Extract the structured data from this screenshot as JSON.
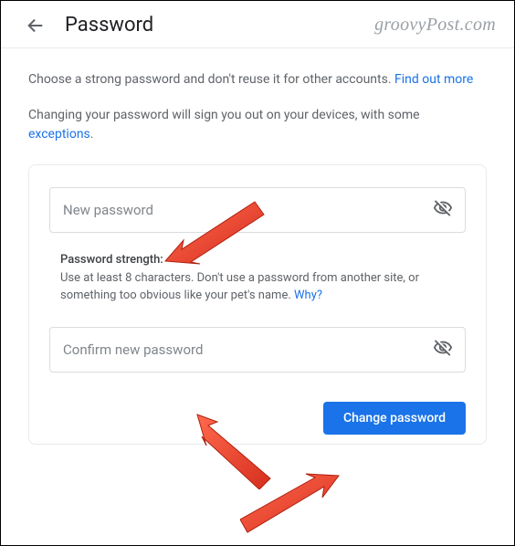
{
  "header": {
    "title": "Password",
    "watermark": "groovyPost.com"
  },
  "intro": {
    "text": "Choose a strong password and don't reuse it for other accounts. ",
    "link": "Find out more"
  },
  "signout": {
    "text": "Changing your password will sign you out on your devices, with some ",
    "link": "exceptions",
    "tail": "."
  },
  "card": {
    "newPassword": {
      "placeholder": "New password"
    },
    "strength": {
      "label": "Password strength:",
      "help": "Use at least 8 characters. Don't use a password from another site, or something too obvious like your pet's name. ",
      "link": "Why?"
    },
    "confirmPassword": {
      "placeholder": "Confirm new password"
    },
    "submit": "Change password"
  }
}
